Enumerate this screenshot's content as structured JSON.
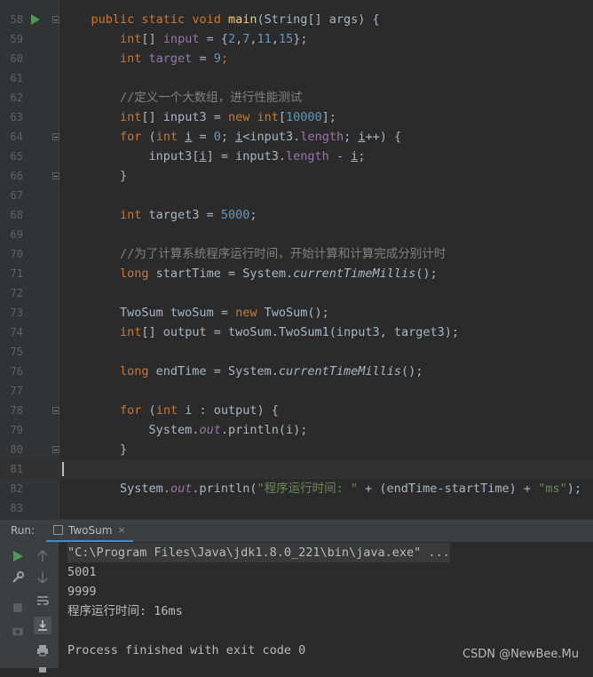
{
  "editor": {
    "lines": [
      {
        "num": "58",
        "tokens": [
          {
            "t": "    "
          },
          {
            "t": "public ",
            "c": "kw"
          },
          {
            "t": "static ",
            "c": "kw"
          },
          {
            "t": "void ",
            "c": "kw"
          },
          {
            "t": "main",
            "c": "fn"
          },
          {
            "t": "(String[] args) {"
          }
        ]
      },
      {
        "num": "59",
        "tokens": [
          {
            "t": "        "
          },
          {
            "t": "int",
            "c": "kw"
          },
          {
            "t": "[] "
          },
          {
            "t": "input",
            "c": "fld"
          },
          {
            "t": " = {"
          },
          {
            "t": "2",
            "c": "num"
          },
          {
            "t": ","
          },
          {
            "t": "7",
            "c": "num"
          },
          {
            "t": ","
          },
          {
            "t": "11",
            "c": "num"
          },
          {
            "t": ","
          },
          {
            "t": "15",
            "c": "num"
          },
          {
            "t": "};"
          }
        ]
      },
      {
        "num": "60",
        "tokens": [
          {
            "t": "        "
          },
          {
            "t": "int ",
            "c": "kw"
          },
          {
            "t": "target",
            "c": "fld"
          },
          {
            "t": " = "
          },
          {
            "t": "9",
            "c": "num"
          },
          {
            "t": ";",
            "c": "kw"
          }
        ]
      },
      {
        "num": "61",
        "tokens": []
      },
      {
        "num": "62",
        "tokens": [
          {
            "t": "        "
          },
          {
            "t": "//定义一个大数组，进行性能测试",
            "c": "cm"
          }
        ]
      },
      {
        "num": "63",
        "tokens": [
          {
            "t": "        "
          },
          {
            "t": "int",
            "c": "kw"
          },
          {
            "t": "[] input3 = "
          },
          {
            "t": "new ",
            "c": "kw"
          },
          {
            "t": "int",
            "c": "kw"
          },
          {
            "t": "["
          },
          {
            "t": "10000",
            "c": "num"
          },
          {
            "t": "];"
          }
        ]
      },
      {
        "num": "64",
        "tokens": [
          {
            "t": "        "
          },
          {
            "t": "for ",
            "c": "kw"
          },
          {
            "t": "("
          },
          {
            "t": "int ",
            "c": "kw"
          },
          {
            "t": "i",
            "c": "ul"
          },
          {
            "t": " = "
          },
          {
            "t": "0",
            "c": "num"
          },
          {
            "t": "; "
          },
          {
            "t": "i",
            "c": "ul"
          },
          {
            "t": "<input3."
          },
          {
            "t": "length",
            "c": "fld"
          },
          {
            "t": "; "
          },
          {
            "t": "i",
            "c": "ul"
          },
          {
            "t": "++) {"
          }
        ]
      },
      {
        "num": "65",
        "tokens": [
          {
            "t": "            "
          },
          {
            "t": "input3["
          },
          {
            "t": "i",
            "c": "ul"
          },
          {
            "t": "] = input3."
          },
          {
            "t": "length",
            "c": "fld"
          },
          {
            "t": " - "
          },
          {
            "t": "i",
            "c": "ul"
          },
          {
            "t": ";"
          }
        ]
      },
      {
        "num": "66",
        "tokens": [
          {
            "t": "        "
          },
          {
            "t": "}"
          }
        ]
      },
      {
        "num": "67",
        "tokens": []
      },
      {
        "num": "68",
        "tokens": [
          {
            "t": "        "
          },
          {
            "t": "int ",
            "c": "kw"
          },
          {
            "t": "target3 = "
          },
          {
            "t": "5000",
            "c": "num"
          },
          {
            "t": ";"
          }
        ]
      },
      {
        "num": "69",
        "tokens": []
      },
      {
        "num": "70",
        "tokens": [
          {
            "t": "        "
          },
          {
            "t": "//为了计算系统程序运行时间，开始计算和计算完成分别计时",
            "c": "cm"
          }
        ]
      },
      {
        "num": "71",
        "tokens": [
          {
            "t": "        "
          },
          {
            "t": "long ",
            "c": "kw"
          },
          {
            "t": "startTime = System."
          },
          {
            "t": "currentTimeMillis",
            "c": "ital"
          },
          {
            "t": "();"
          }
        ]
      },
      {
        "num": "72",
        "tokens": []
      },
      {
        "num": "73",
        "tokens": [
          {
            "t": "        "
          },
          {
            "t": "TwoSum twoSum = "
          },
          {
            "t": "new ",
            "c": "kw"
          },
          {
            "t": "TwoSum();"
          }
        ]
      },
      {
        "num": "74",
        "tokens": [
          {
            "t": "        "
          },
          {
            "t": "int",
            "c": "kw"
          },
          {
            "t": "[] output = twoSum.TwoSum1(input3, target3);"
          }
        ]
      },
      {
        "num": "75",
        "tokens": []
      },
      {
        "num": "76",
        "tokens": [
          {
            "t": "        "
          },
          {
            "t": "long ",
            "c": "kw"
          },
          {
            "t": "endTime = System."
          },
          {
            "t": "currentTimeMillis",
            "c": "ital"
          },
          {
            "t": "();"
          }
        ]
      },
      {
        "num": "77",
        "tokens": []
      },
      {
        "num": "78",
        "tokens": [
          {
            "t": "        "
          },
          {
            "t": "for ",
            "c": "kw"
          },
          {
            "t": "("
          },
          {
            "t": "int ",
            "c": "kw"
          },
          {
            "t": "i : output) {"
          }
        ]
      },
      {
        "num": "79",
        "tokens": [
          {
            "t": "            "
          },
          {
            "t": "System."
          },
          {
            "t": "out",
            "c": "fld ital"
          },
          {
            "t": ".println(i);"
          }
        ]
      },
      {
        "num": "80",
        "tokens": [
          {
            "t": "        "
          },
          {
            "t": "}"
          }
        ]
      },
      {
        "num": "81",
        "tokens": []
      },
      {
        "num": "82",
        "tokens": [
          {
            "t": "        "
          },
          {
            "t": "System."
          },
          {
            "t": "out",
            "c": "fld ital"
          },
          {
            "t": ".println("
          },
          {
            "t": "\"程序运行时间: \"",
            "c": "str"
          },
          {
            "t": " + (endTime-startTime) + "
          },
          {
            "t": "\"ms\"",
            "c": "str"
          },
          {
            "t": ");"
          }
        ]
      },
      {
        "num": "83",
        "tokens": []
      }
    ]
  },
  "run_panel": {
    "label": "Run:",
    "tab_label": "TwoSum",
    "close_glyph": "×"
  },
  "console": {
    "lines": [
      "\"C:\\Program Files\\Java\\jdk1.8.0_221\\bin\\java.exe\" ...",
      "5001",
      "9999",
      "程序运行时间: 16ms",
      "",
      "Process finished with exit code 0"
    ]
  },
  "toolbar": {
    "icons": [
      "run-icon",
      "up-arrow-icon",
      "wrench-icon",
      "down-arrow-icon",
      "stop-icon",
      "soft-wrap-icon",
      "camera-icon",
      "scroll-to-end-icon",
      "print-icon"
    ]
  },
  "watermark": "CSDN @NewBee.Mu",
  "colors": {
    "keyword": "#cc7832",
    "number": "#6897bb",
    "string": "#6a8759",
    "comment": "#808080",
    "function": "#ffc66d",
    "field": "#9876aa",
    "text": "#a9b7c6"
  }
}
